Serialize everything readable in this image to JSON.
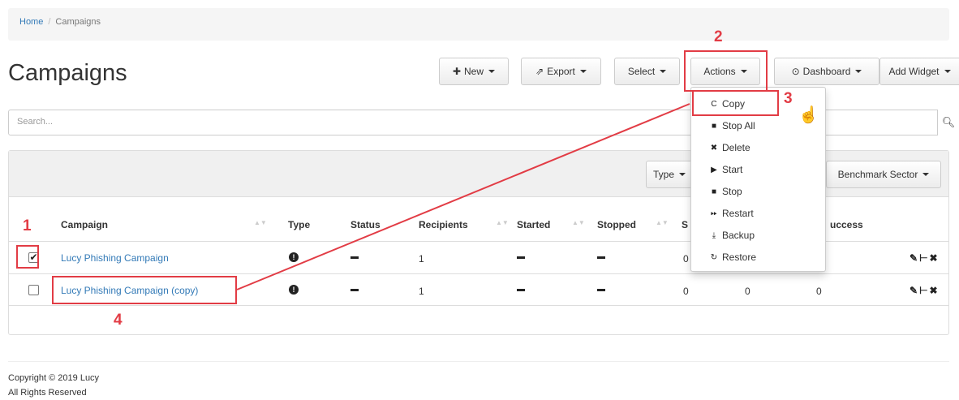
{
  "breadcrumb": {
    "home": "Home",
    "separator": "/",
    "current": "Campaigns"
  },
  "page_title": "Campaigns",
  "toolbar": {
    "new_label": "New",
    "export_label": "Export",
    "select_label": "Select",
    "actions_label": "Actions",
    "dashboard_label": "Dashboard",
    "add_widget_label": "Add Widget",
    "new_icon": "plus-icon",
    "export_icon": "export-icon",
    "dashboard_icon": "dashboard-icon"
  },
  "search": {
    "placeholder": "Search..."
  },
  "filters": {
    "type_label": "Type",
    "benchmark_label": "Benchmark Sector"
  },
  "table": {
    "headers": {
      "campaign": "Campaign",
      "type": "Type",
      "status": "Status",
      "recipients": "Recipients",
      "started": "Started",
      "stopped": "Stopped",
      "s_partial": "S",
      "success": "uccess"
    },
    "rows": [
      {
        "checked": true,
        "name": "Lucy Phishing Campaign",
        "recipients": "1",
        "col_a": "0",
        "col_b": "",
        "col_c": ""
      },
      {
        "checked": false,
        "name": "Lucy Phishing Campaign (copy)",
        "recipients": "1",
        "col_a": "0",
        "col_b": "0",
        "col_c": "0"
      }
    ]
  },
  "actions_menu": {
    "items": [
      {
        "label": "Copy",
        "icon": "copy-icon"
      },
      {
        "label": "Stop All",
        "icon": "stop-icon"
      },
      {
        "label": "Delete",
        "icon": "delete-icon"
      },
      {
        "label": "Start",
        "icon": "play-icon"
      },
      {
        "label": "Stop",
        "icon": "stop-icon"
      },
      {
        "label": "Restart",
        "icon": "fast-forward-icon"
      },
      {
        "label": "Backup",
        "icon": "download-icon"
      },
      {
        "label": "Restore",
        "icon": "refresh-icon"
      }
    ]
  },
  "annotations": {
    "step1": "1",
    "step2": "2",
    "step3": "3",
    "step4": "4",
    "color": "#e23c45"
  },
  "footer": {
    "copyright": "Copyright © 2019 Lucy",
    "rights": "All Rights Reserved"
  }
}
